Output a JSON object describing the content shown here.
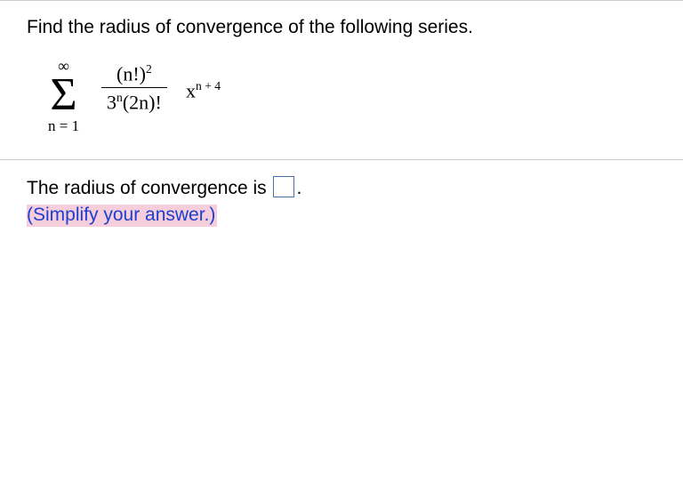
{
  "divider": true,
  "question": {
    "text": "Find the radius of convergence of the following series."
  },
  "formula": {
    "sigma_top": "∞",
    "sigma_symbol": "Σ",
    "sigma_bottom": "n = 1",
    "numerator_base": "(n!)",
    "numerator_exp": "2",
    "denominator_a_base": "3",
    "denominator_a_exp": "n",
    "denominator_b": "(2n)!",
    "x_base": "x",
    "x_exp": "n + 4"
  },
  "answer": {
    "prefix": "The radius of convergence is ",
    "suffix": ".",
    "hint": "(Simplify your answer.)"
  }
}
